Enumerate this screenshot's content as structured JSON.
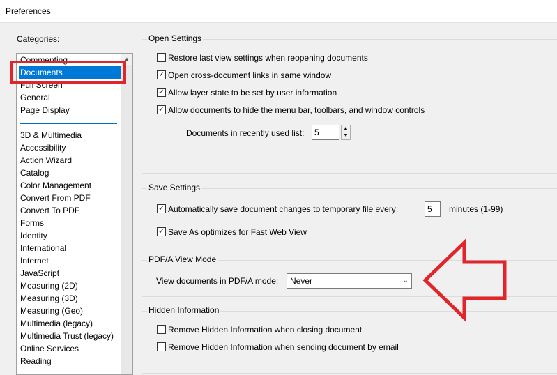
{
  "window": {
    "title": "Preferences"
  },
  "categories": {
    "label": "Categories:",
    "items": [
      {
        "label": "Commenting"
      },
      {
        "label": "Documents",
        "selected": true
      },
      {
        "label": "Full Screen"
      },
      {
        "label": "General"
      },
      {
        "label": "Page Display"
      },
      {
        "label": "3D & Multimedia"
      },
      {
        "label": "Accessibility"
      },
      {
        "label": "Action Wizard"
      },
      {
        "label": "Catalog"
      },
      {
        "label": "Color Management"
      },
      {
        "label": "Convert From PDF"
      },
      {
        "label": "Convert To PDF"
      },
      {
        "label": "Forms"
      },
      {
        "label": "Identity"
      },
      {
        "label": "International"
      },
      {
        "label": "Internet"
      },
      {
        "label": "JavaScript"
      },
      {
        "label": "Measuring (2D)"
      },
      {
        "label": "Measuring (3D)"
      },
      {
        "label": "Measuring (Geo)"
      },
      {
        "label": "Multimedia (legacy)"
      },
      {
        "label": "Multimedia Trust (legacy)"
      },
      {
        "label": "Online Services"
      },
      {
        "label": "Reading"
      }
    ]
  },
  "open_settings": {
    "title": "Open Settings",
    "options": [
      {
        "label": "Restore last view settings when reopening documents",
        "checked": false
      },
      {
        "label": "Open cross-document links in same window",
        "checked": true
      },
      {
        "label": "Allow layer state to be set by user information",
        "checked": true
      },
      {
        "label": "Allow documents to hide the menu bar, toolbars, and window controls",
        "checked": true
      }
    ],
    "recent_list_label": "Documents in recently used list:",
    "recent_list_value": "5"
  },
  "save_settings": {
    "title": "Save Settings",
    "autosave_label": "Automatically save document changes to temporary file every:",
    "autosave_checked": true,
    "autosave_minutes": "5",
    "minutes_unit": "minutes (1-99)",
    "fast_web_label": "Save As optimizes for Fast Web View",
    "fast_web_checked": true
  },
  "pdfa": {
    "title": "PDF/A View Mode",
    "label": "View documents in PDF/A mode:",
    "value": "Never"
  },
  "hidden_info": {
    "title": "Hidden Information",
    "options": [
      {
        "label": "Remove Hidden Information when closing document",
        "checked": false
      },
      {
        "label": "Remove Hidden Information when sending document by email",
        "checked": false
      }
    ]
  },
  "annotations": {
    "highlight_color": "#e2242b"
  }
}
